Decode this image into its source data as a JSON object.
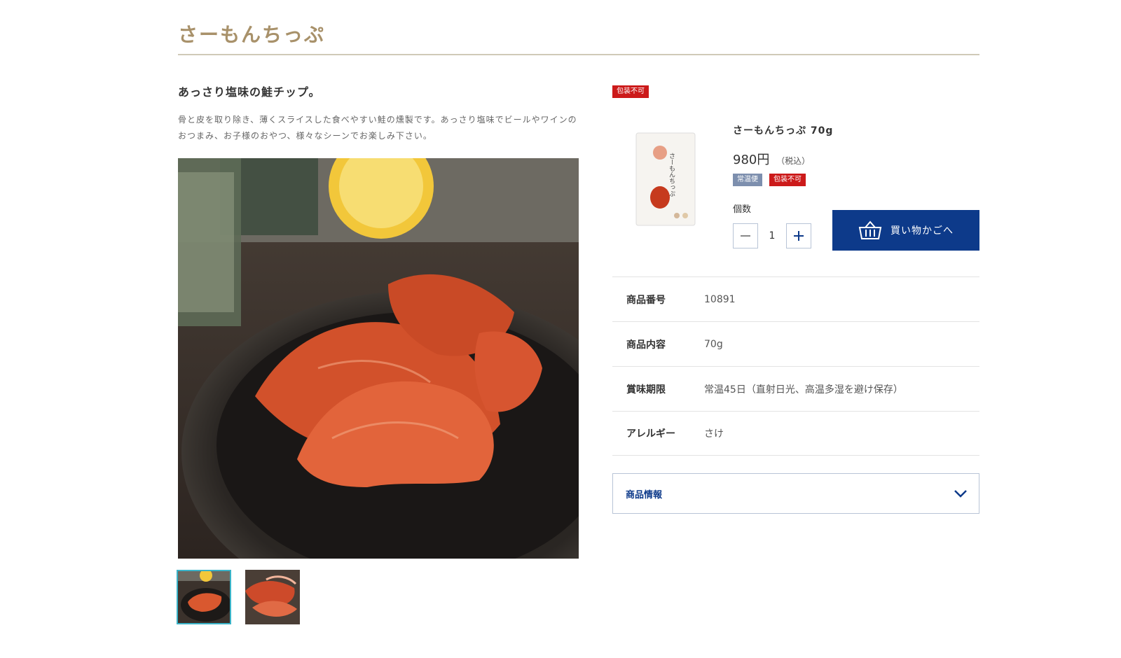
{
  "header": {
    "title": "さーもんちっぷ"
  },
  "intro": {
    "catchphrase": "あっさり塩味の鮭チップ。",
    "description": "骨と皮を取り除き、薄くスライスした食べやすい鮭の燻製です。あっさり塩味でビールやワインのおつまみ、お子様のおやつ、様々なシーンでお楽しみ下さい。"
  },
  "gallery": {
    "thumbnails": [
      "thumbnail-1",
      "thumbnail-2"
    ]
  },
  "product": {
    "top_badge": "包装不可",
    "name": "さーもんちっぷ 70g",
    "price": "980円",
    "tax_note": "（税込）",
    "badges": [
      "常温便",
      "包装不可"
    ],
    "quantity_label": "個数",
    "quantity": "1",
    "cart_button": "買い物かごへ",
    "package_text": "さーもんちっぷ"
  },
  "specs": [
    {
      "label": "商品番号",
      "value": "10891"
    },
    {
      "label": "商品内容",
      "value": "70g"
    },
    {
      "label": "賞味期限",
      "value": "常温45日（直射日光、高温多湿を避け保存）"
    },
    {
      "label": "アレルギー",
      "value": "さけ"
    }
  ],
  "accordion": {
    "label": "商品情報"
  },
  "colors": {
    "title": "#a8916a",
    "accent": "#0d3a8a",
    "badge_red": "#cc1a1a",
    "badge_gray": "#7d8fae",
    "thumb_active": "#3ab3c8"
  },
  "icons": {
    "cart": "basket-icon",
    "minus": "minus-icon",
    "plus": "plus-icon",
    "accordion": "chevron-down-icon"
  }
}
